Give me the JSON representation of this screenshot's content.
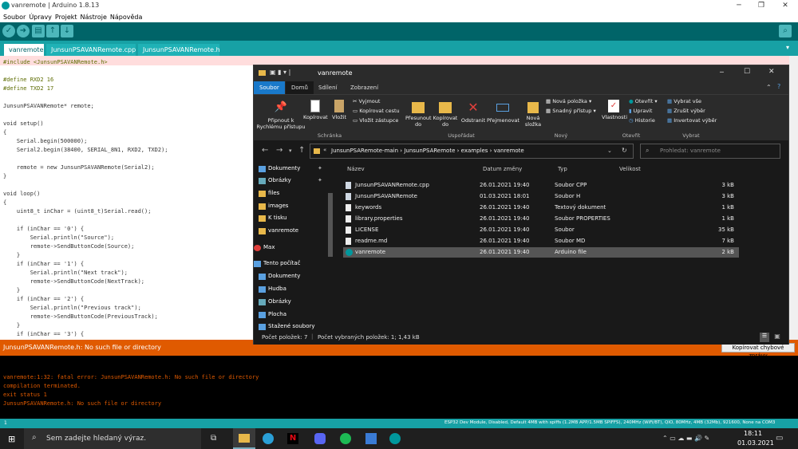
{
  "arduino": {
    "title": "vanremote | Arduino 1.8.13",
    "menu": [
      "Soubor",
      "Úpravy",
      "Projekt",
      "Nástroje",
      "Nápověda"
    ],
    "tabs": [
      "vanremote",
      "JunsunPSAVANRemote.cpp",
      "JunsunPSAVANRemote.h"
    ],
    "code": [
      "#include <JunsunPSAVANRemote.h>",
      "",
      "#define RXD2 16",
      "#define TXD2 17",
      "",
      "JunsunPSAVANRemote* remote;",
      "",
      "void setup()",
      "{",
      "    Serial.begin(500000);",
      "    Serial2.begin(38400, SERIAL_8N1, RXD2, TXD2);",
      "",
      "    remote = new JunsunPSAVANRemote(Serial2);",
      "}",
      "",
      "void loop()",
      "{",
      "    uint8_t inChar = (uint8_t)Serial.read();",
      "",
      "    if (inChar == '0') {",
      "        Serial.println(\"Source\");",
      "        remote->SendButtonCode(Source);",
      "    }",
      "    if (inChar == '1') {",
      "        Serial.println(\"Next track\");",
      "        remote->SendButtonCode(NextTrack);",
      "    }",
      "    if (inChar == '2') {",
      "        Serial.println(\"Previous track\");",
      "        remote->SendButtonCode(PreviousTrack);",
      "    }",
      "    if (inChar == '3') {"
    ],
    "error_message": "JunsunPSAVANRemote.h: No such file or directory",
    "copy_errors_label": "Kopírovat chybové zprávy",
    "console": [
      "vanremote:1:32: fatal error: JunsunPSAVANRemote.h: No such file or directory",
      "compilation terminated.",
      "exit status 1",
      "JunsunPSAVANRemote.h: No such file or directory"
    ],
    "line_number": "1",
    "board_info": "ESP32 Dev Module, Disabled, Default 4MB with spiffs (1.2MB APP/1.5MB SPIFFS), 240MHz (WiFi/BT), QIO, 80MHz, 4MB (32Mb), 921600, None na COM3"
  },
  "explorer": {
    "title": "vanremote",
    "ribbon_tabs": [
      "Soubor",
      "Domů",
      "Sdílení",
      "Zobrazení"
    ],
    "ribbon": {
      "pin_quick": "Připnout k Rychlému přístupu",
      "copy": "Kopírovat",
      "paste": "Vložit",
      "cut": "Vyjmout",
      "copy_path": "Kopírovat cestu",
      "paste_shortcut": "Vložit zástupce",
      "group_clipboard": "Schránka",
      "move_to": "Přesunout do",
      "copy_to": "Kopírovat do",
      "delete": "Odstranit",
      "rename": "Přejmenovat",
      "group_organize": "Uspořádat",
      "new_folder": "Nová složka",
      "new_item": "Nová položka",
      "easy_access": "Snadný přístup",
      "group_new": "Nový",
      "properties": "Vlastnosti",
      "open": "Otevřít",
      "edit": "Upravit",
      "history": "Historie",
      "group_open": "Otevřít",
      "select_all": "Vybrat vše",
      "select_none": "Zrušit výběr",
      "invert_selection": "Invertovat výběr",
      "group_select": "Vybrat"
    },
    "breadcrumb": [
      "JunsunPSARemote-main",
      "JunsunPSARemote",
      "examples",
      "vanremote"
    ],
    "search_placeholder": "Prohledat: vanremote",
    "nav": [
      {
        "label": "Dokumenty",
        "pinned": true
      },
      {
        "label": "Obrázky",
        "pinned": true
      },
      {
        "label": "files",
        "pinned": false
      },
      {
        "label": "images",
        "pinned": false
      },
      {
        "label": "K tisku",
        "pinned": false
      },
      {
        "label": "vanremote",
        "pinned": false
      },
      {
        "label": "Max",
        "pinned": false
      },
      {
        "label": "Tento počítač",
        "pinned": false
      },
      {
        "label": "Dokumenty",
        "pinned": false
      },
      {
        "label": "Hudba",
        "pinned": false
      },
      {
        "label": "Obrázky",
        "pinned": false
      },
      {
        "label": "Plocha",
        "pinned": false
      },
      {
        "label": "Stažené soubory",
        "pinned": false
      }
    ],
    "columns": [
      "Název",
      "Datum změny",
      "Typ",
      "Velikost"
    ],
    "files": [
      {
        "name": "JunsunPSAVANRemote.cpp",
        "date": "26.01.2021 19:40",
        "type": "Soubor CPP",
        "size": "3 kB"
      },
      {
        "name": "JunsunPSAVANRemote",
        "date": "01.03.2021 18:01",
        "type": "Soubor H",
        "size": "3 kB"
      },
      {
        "name": "keywords",
        "date": "26.01.2021 19:40",
        "type": "Textový dokument",
        "size": "1 kB"
      },
      {
        "name": "library.properties",
        "date": "26.01.2021 19:40",
        "type": "Soubor PROPERTIES",
        "size": "1 kB"
      },
      {
        "name": "LICENSE",
        "date": "26.01.2021 19:40",
        "type": "Soubor",
        "size": "35 kB"
      },
      {
        "name": "readme.md",
        "date": "26.01.2021 19:40",
        "type": "Soubor MD",
        "size": "7 kB"
      },
      {
        "name": "vanremote",
        "date": "26.01.2021 19:40",
        "type": "Arduino file",
        "size": "2 kB"
      }
    ],
    "status_count": "Počet položek: 7",
    "status_selected": "Počet vybraných položek: 1; 1,43 kB"
  },
  "taskbar": {
    "search_placeholder": "Sem zadejte hledaný výraz.",
    "time": "18:11",
    "date": "01.03.2021"
  }
}
